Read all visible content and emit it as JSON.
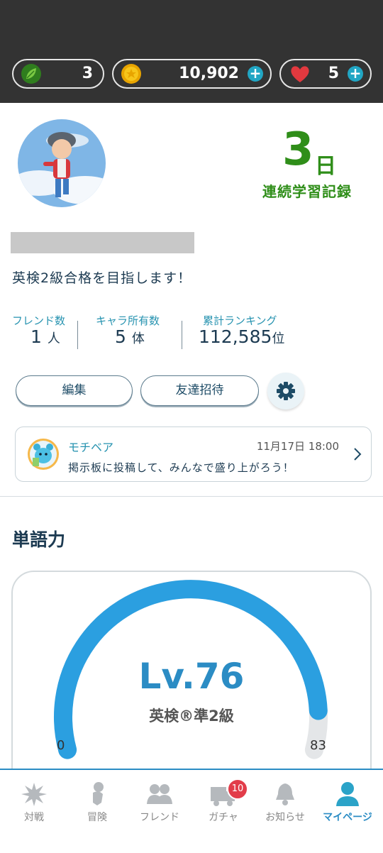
{
  "header": {
    "leaves": "3",
    "coins": "10,902",
    "hearts": "5",
    "leaf_icon": "leaf-icon",
    "coin_icon": "coin-icon",
    "heart_icon": "heart-icon"
  },
  "profile": {
    "streak_value": "3",
    "streak_unit": "日",
    "streak_label": "連続学習記録",
    "goal": "英検2級合格を目指します！"
  },
  "stats": [
    {
      "label": "フレンド数",
      "value": "1",
      "unit": "人"
    },
    {
      "label": "キャラ所有数",
      "value": "5",
      "unit": "体"
    },
    {
      "label": "累計ランキング",
      "value": "112,585",
      "unit": "位"
    }
  ],
  "buttons": {
    "edit": "編集",
    "invite": "友達招待"
  },
  "notice": {
    "sender": "モチベア",
    "time": "11月17日 18:00",
    "message": "掲示板に投稿して、みんなで盛り上がろう！"
  },
  "vocab": {
    "title": "単語力",
    "level": "Lv.76",
    "grade": "英検®準2級",
    "min": "0",
    "max": "83",
    "level_value": 76,
    "accent": "#2b9fe0"
  },
  "tabs": [
    {
      "label": "対戦",
      "icon": "battle-icon"
    },
    {
      "label": "冒険",
      "icon": "adventure-icon"
    },
    {
      "label": "フレンド",
      "icon": "friends-icon"
    },
    {
      "label": "ガチャ",
      "icon": "gacha-icon",
      "badge": "10"
    },
    {
      "label": "お知らせ",
      "icon": "bell-icon"
    },
    {
      "label": "マイページ",
      "icon": "mypage-icon",
      "active": true
    }
  ],
  "colors": {
    "streak": "#2f8e19",
    "link": "#2793b0",
    "active_tab": "#2b8cc4"
  }
}
